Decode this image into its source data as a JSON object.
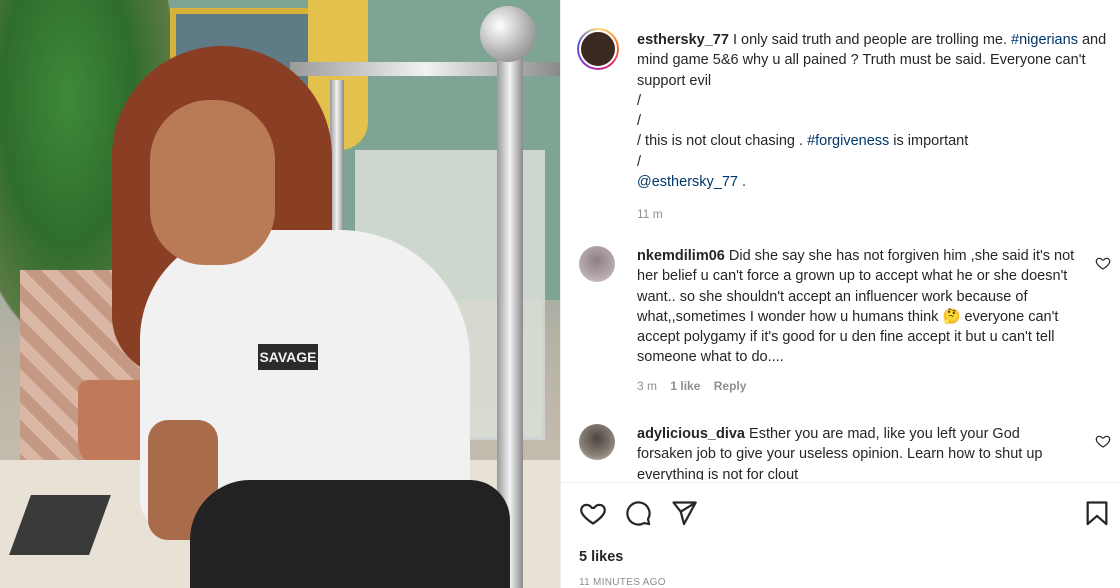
{
  "post": {
    "author": "esthersky_77",
    "caption": {
      "p1": " I only said truth and people are trolling me. ",
      "hashtag1": "#nigerians",
      "p2": " and mind game 5&6 why u all pained ? Truth must be said. Everyone can't support evil",
      "slash1": "/",
      "slash2": "/",
      "p3_slash": "/ this is not clout chasing . ",
      "hashtag2": "#forgiveness",
      "p3": " is important",
      "slash3": "/",
      "mention": "@esthersky_77",
      "p4": " ."
    },
    "time": "11 m"
  },
  "comments": [
    {
      "username": "nkemdilim06",
      "text": " Did she say she has not forgiven him ,she said it's not her belief u can't force a grown up to accept what he or she doesn't want.. so she shouldn't accept an influencer work because of what,,sometimes I wonder how u humans think 🤔 everyone can't accept polygamy if it's good for u den fine accept it but u can't tell someone what to do....",
      "time": "3 m",
      "likes": "1 like",
      "reply": "Reply"
    },
    {
      "username": "adylicious_diva",
      "text": " Esther you are mad, like you left your God forsaken job to give your useless opinion. Learn how to shut up everything is not for clout",
      "time": "",
      "likes": "",
      "reply": ""
    }
  ],
  "actions": {
    "likes": "5 likes",
    "timeago": "11 minutes ago"
  },
  "photo": {
    "shirt_text": "SAVAGE"
  },
  "icons": {
    "like": "heart-icon",
    "comment": "comment-bubble-icon",
    "share": "paper-plane-icon",
    "save": "bookmark-icon"
  },
  "colors": {
    "hashtag": "#00376b",
    "muted": "#8e8e8e",
    "text": "#262626"
  }
}
